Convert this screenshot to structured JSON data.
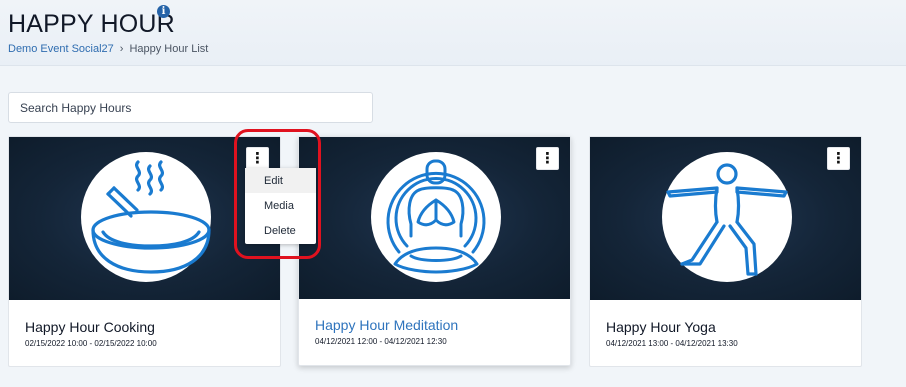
{
  "header": {
    "title": "HAPPY HOUR",
    "info_icon_glyph": "i",
    "breadcrumb": [
      {
        "label": "Demo Event Social27",
        "link": true
      },
      {
        "label": "Happy Hour List",
        "link": false
      }
    ],
    "breadcrumb_separator": "›"
  },
  "search": {
    "placeholder": "Search Happy Hours",
    "value": ""
  },
  "cards": [
    {
      "title": "Happy Hour Cooking",
      "dates": "02/15/2022 10:00 - 02/15/2022 10:00",
      "icon": "frying-pan-icon",
      "menu_glyph": "⋮"
    },
    {
      "title": "Happy Hour Meditation",
      "dates": "04/12/2021 12:00 - 04/12/2021 12:30",
      "icon": "meditation-icon",
      "menu_glyph": "⋮",
      "hovered": true
    },
    {
      "title": "Happy Hour Yoga",
      "dates": "04/12/2021 13:00 - 04/12/2021 13:30",
      "icon": "yoga-pose-icon",
      "menu_glyph": "⋮"
    }
  ],
  "card_menu": {
    "open_on_card": 0,
    "items": [
      "Edit",
      "Media",
      "Delete"
    ]
  },
  "colors": {
    "accent": "#2f74bd",
    "icon_stroke": "#1a7bd0",
    "card_image_bg": "#142538",
    "highlight": "#e0121f"
  }
}
